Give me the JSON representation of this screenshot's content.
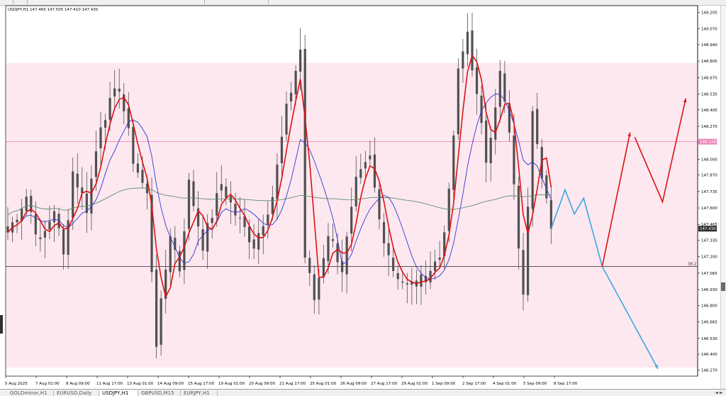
{
  "header": {
    "info_text": "USDJPY,H1  147.465 147.505 147.410 147.430"
  },
  "price_axis": {
    "ticks": [
      "149.205",
      "149.070",
      "148.940",
      "148.805",
      "148.670",
      "148.535",
      "148.405",
      "148.270",
      "148.135",
      "148.000",
      "147.870",
      "147.735",
      "147.600",
      "147.465",
      "147.335",
      "147.200",
      "147.065",
      "146.930",
      "146.800",
      "146.665",
      "146.530",
      "146.400",
      "146.270"
    ],
    "current_price": "147.430",
    "hline_label": "148.144",
    "fib_label": "38.2"
  },
  "time_axis": {
    "labels": [
      "5 Aug 2025",
      "7 Aug 01:00",
      "8 Aug 09:00",
      "11 Aug 17:00",
      "13 Aug 01:00",
      "14 Aug 09:00",
      "15 Aug 17:00",
      "19 Aug 01:00",
      "20 Aug 09:00",
      "21 Aug 17:00",
      "25 Aug 01:00",
      "26 Aug 09:00",
      "27 Aug 17:00",
      "29 Aug 01:00",
      "1 Sep 09:00",
      "2 Sep 17:00",
      "4 Sep 01:00",
      "5 Sep 09:00",
      "8 Sep 17:00"
    ]
  },
  "tabs": [
    {
      "label": "GOLDminor,H1",
      "active": false
    },
    {
      "label": "EURUSD,Daily",
      "active": false
    },
    {
      "label": "USDJPY,H1",
      "active": true
    },
    {
      "label": "GBPUSD,M15",
      "active": false
    },
    {
      "label": "EURJPY,H1",
      "active": false
    }
  ],
  "tabs_scroll": "◄ ►",
  "colors": {
    "zone": "#fde8ef",
    "candle": "#505050",
    "ma_fast": "#dd1111",
    "ma_mid": "#3535d0",
    "ma_slow": "#5e8f6e",
    "hline": "#e880b4",
    "fib": "#404040",
    "arrow_bull": "#dd1111",
    "arrow_bear": "#3aa8e0",
    "price_tag": "#2d2d2d",
    "hline_tag": "#ee88bb"
  },
  "chart_data": {
    "type": "candlestick",
    "symbol": "USDJPY",
    "timeframe": "H1",
    "ohlc_header": {
      "open": 147.465,
      "high": 147.505,
      "low": 147.41,
      "close": 147.43
    },
    "y_range": [
      146.22,
      149.26
    ],
    "zone": [
      146.29,
      148.79
    ],
    "horizontal_line": 148.144,
    "fib_level": {
      "label": "38.2",
      "price": 147.12
    },
    "price_path": [
      {
        "t": 0,
        "p": 147.4
      },
      {
        "t": 4,
        "p": 147.7
      },
      {
        "t": 7,
        "p": 147.3
      },
      {
        "t": 10,
        "p": 147.6
      },
      {
        "t": 12,
        "p": 147.2
      },
      {
        "t": 14,
        "p": 147.9
      },
      {
        "t": 17,
        "p": 147.6
      },
      {
        "t": 20,
        "p": 148.3
      },
      {
        "t": 24,
        "p": 148.6
      },
      {
        "t": 27,
        "p": 148.0
      },
      {
        "t": 30,
        "p": 147.7
      },
      {
        "t": 32,
        "p": 146.5
      },
      {
        "t": 35,
        "p": 147.4
      },
      {
        "t": 37,
        "p": 147.1
      },
      {
        "t": 39,
        "p": 147.8
      },
      {
        "t": 42,
        "p": 147.3
      },
      {
        "t": 46,
        "p": 147.8
      },
      {
        "t": 49,
        "p": 147.55
      },
      {
        "t": 53,
        "p": 147.3
      },
      {
        "t": 57,
        "p": 147.7
      },
      {
        "t": 60,
        "p": 148.4
      },
      {
        "t": 63,
        "p": 148.9
      },
      {
        "t": 64,
        "p": 147.2
      },
      {
        "t": 66,
        "p": 146.85
      },
      {
        "t": 69,
        "p": 147.4
      },
      {
        "t": 72,
        "p": 147.1
      },
      {
        "t": 75,
        "p": 147.8
      },
      {
        "t": 78,
        "p": 148.0
      },
      {
        "t": 80,
        "p": 147.5
      },
      {
        "t": 83,
        "p": 147.1
      },
      {
        "t": 86,
        "p": 146.95
      },
      {
        "t": 89,
        "p": 147.0
      },
      {
        "t": 93,
        "p": 147.2
      },
      {
        "t": 95,
        "p": 147.7
      },
      {
        "t": 97,
        "p": 148.7
      },
      {
        "t": 99,
        "p": 149.05
      },
      {
        "t": 101,
        "p": 148.5
      },
      {
        "t": 103,
        "p": 148.0
      },
      {
        "t": 106,
        "p": 148.7
      },
      {
        "t": 108,
        "p": 148.2
      },
      {
        "t": 110,
        "p": 147.3
      },
      {
        "t": 111,
        "p": 146.85
      },
      {
        "t": 113,
        "p": 148.45
      },
      {
        "t": 115,
        "p": 147.9
      },
      {
        "t": 117,
        "p": 147.45
      }
    ],
    "bars": 118,
    "projection_bear": [
      {
        "x": 117,
        "p": 147.43
      },
      {
        "x": 120,
        "p": 147.75
      },
      {
        "x": 122,
        "p": 147.55
      },
      {
        "x": 124,
        "p": 147.68
      },
      {
        "x": 128,
        "p": 147.12
      },
      {
        "x": 140,
        "p": 146.28
      }
    ],
    "projection_bull": [
      {
        "x": 128,
        "p": 147.12
      },
      {
        "x": 134,
        "p": 148.22
      }
    ],
    "projection_bull2": [
      {
        "x": 135,
        "p": 148.18
      },
      {
        "x": 141,
        "p": 147.65
      },
      {
        "x": 146,
        "p": 148.5
      }
    ]
  }
}
